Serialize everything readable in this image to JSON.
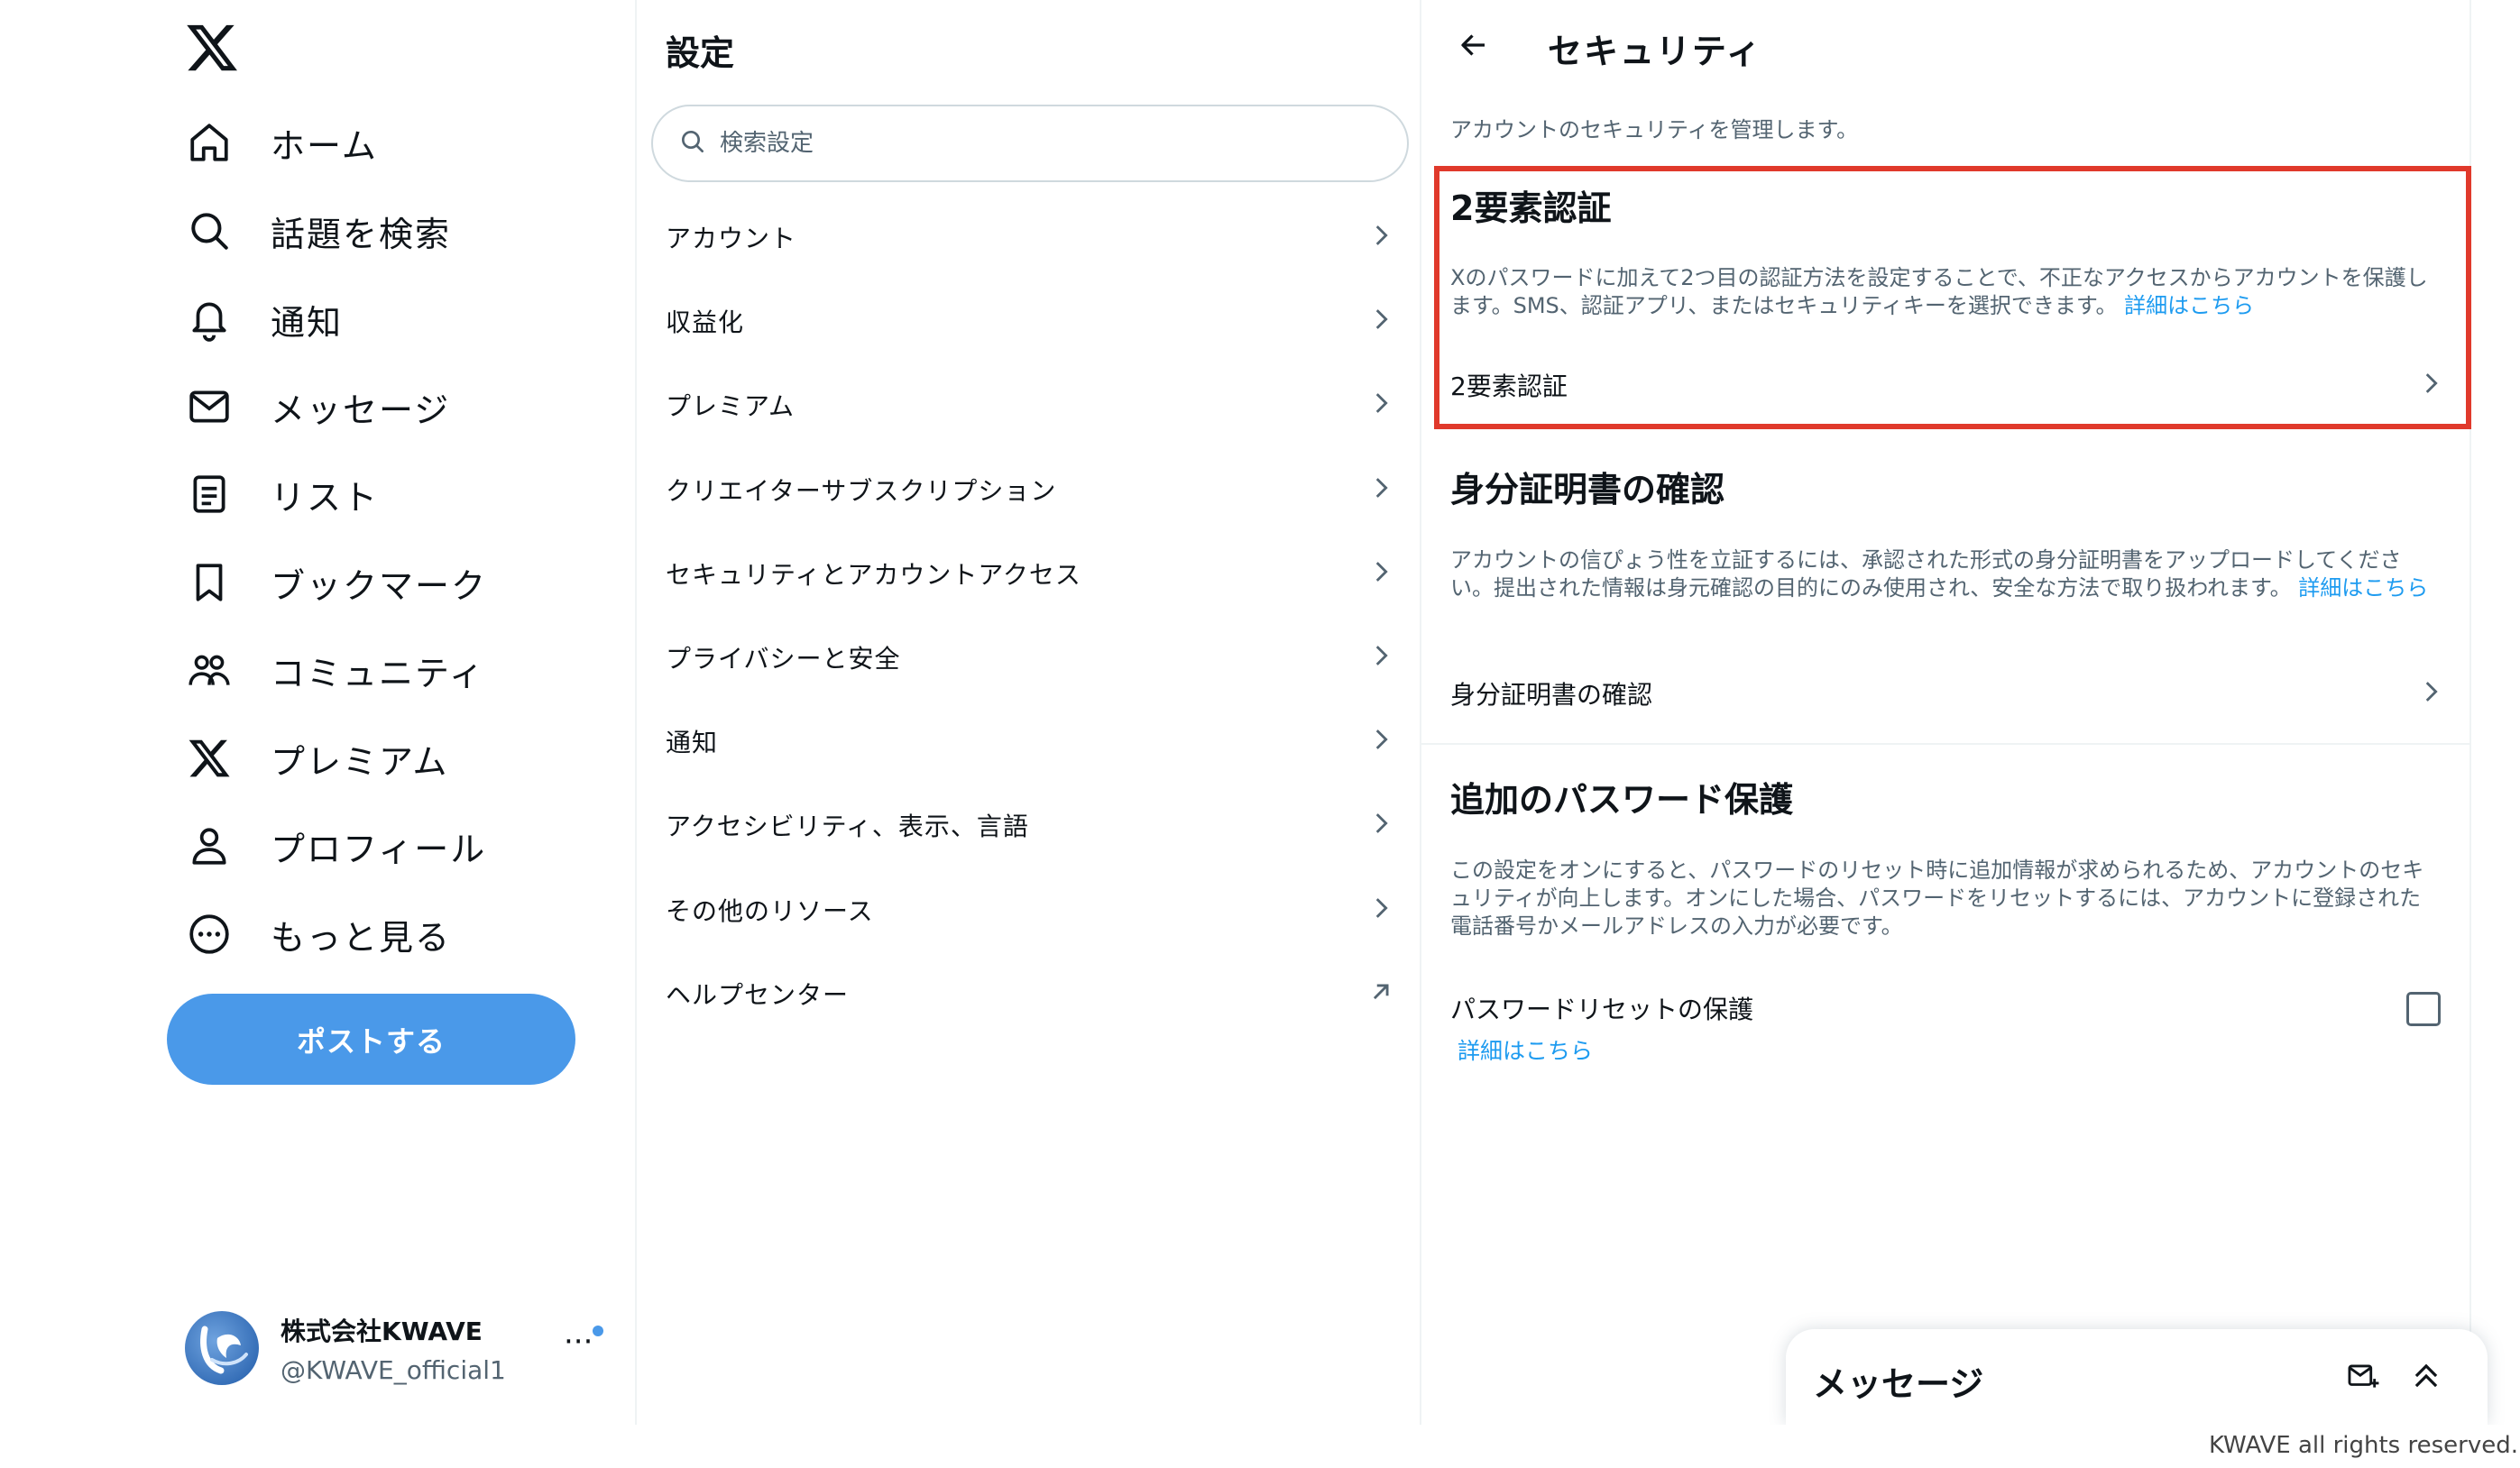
{
  "nav": {
    "items": [
      {
        "label": "ホーム",
        "icon": "home-icon"
      },
      {
        "label": "話題を検索",
        "icon": "search-icon"
      },
      {
        "label": "通知",
        "icon": "bell-icon"
      },
      {
        "label": "メッセージ",
        "icon": "mail-icon"
      },
      {
        "label": "リスト",
        "icon": "list-icon"
      },
      {
        "label": "ブックマーク",
        "icon": "bookmark-icon"
      },
      {
        "label": "コミュニティ",
        "icon": "community-icon"
      },
      {
        "label": "プレミアム",
        "icon": "x-logo-icon"
      },
      {
        "label": "プロフィール",
        "icon": "person-icon"
      },
      {
        "label": "もっと見る",
        "icon": "more-circle-icon"
      }
    ],
    "post_button": "ポストする"
  },
  "account": {
    "name": "株式会社KWAVE",
    "handle": "@KWAVE_official1",
    "more": "···"
  },
  "settings": {
    "title": "設定",
    "search_placeholder": "検索設定",
    "items": [
      {
        "label": "アカウント"
      },
      {
        "label": "収益化"
      },
      {
        "label": "プレミアム"
      },
      {
        "label": "クリエイターサブスクリプション"
      },
      {
        "label": "セキュリティとアカウントアクセス"
      },
      {
        "label": "プライバシーと安全"
      },
      {
        "label": "通知"
      },
      {
        "label": "アクセシビリティ、表示、言語"
      },
      {
        "label": "その他のリソース"
      },
      {
        "label": "ヘルプセンター"
      }
    ]
  },
  "security": {
    "title": "セキュリティ",
    "subtitle": "アカウントのセキュリティを管理します。",
    "two_factor": {
      "heading": "2要素認証",
      "desc": "Xのパスワードに加えて2つ目の認証方法を設定することで、不正なアクセスからアカウントを保護します。SMS、認証アプリ、またはセキュリティキーを選択できます。",
      "link": "詳細はこちら",
      "row": "2要素認証"
    },
    "id_verification": {
      "heading": "身分証明書の確認",
      "desc": "アカウントの信ぴょう性を立証するには、承認された形式の身分証明書をアップロードしてください。提出された情報は身元確認の目的にのみ使用され、安全な方法で取り扱われます。",
      "link": "詳細はこちら",
      "row": "身分証明書の確認"
    },
    "password_protection": {
      "heading": "追加のパスワード保護",
      "desc": "この設定をオンにすると、パスワードのリセット時に追加情報が求められるため、アカウントのセキュリティが向上します。オンにした場合、パスワードをリセットするには、アカウントに登録された電話番号かメールアドレスの入力が必要です。",
      "row": "パスワードリセットの保護",
      "link": "詳細はこちら",
      "checked": false
    }
  },
  "messages_drawer": {
    "title": "メッセージ"
  },
  "footer": {
    "text": "KWAVE all rights reserved."
  },
  "colors": {
    "accent": "#1d9bf0",
    "post_button": "#4a99e9",
    "highlight": "#e0392b"
  }
}
